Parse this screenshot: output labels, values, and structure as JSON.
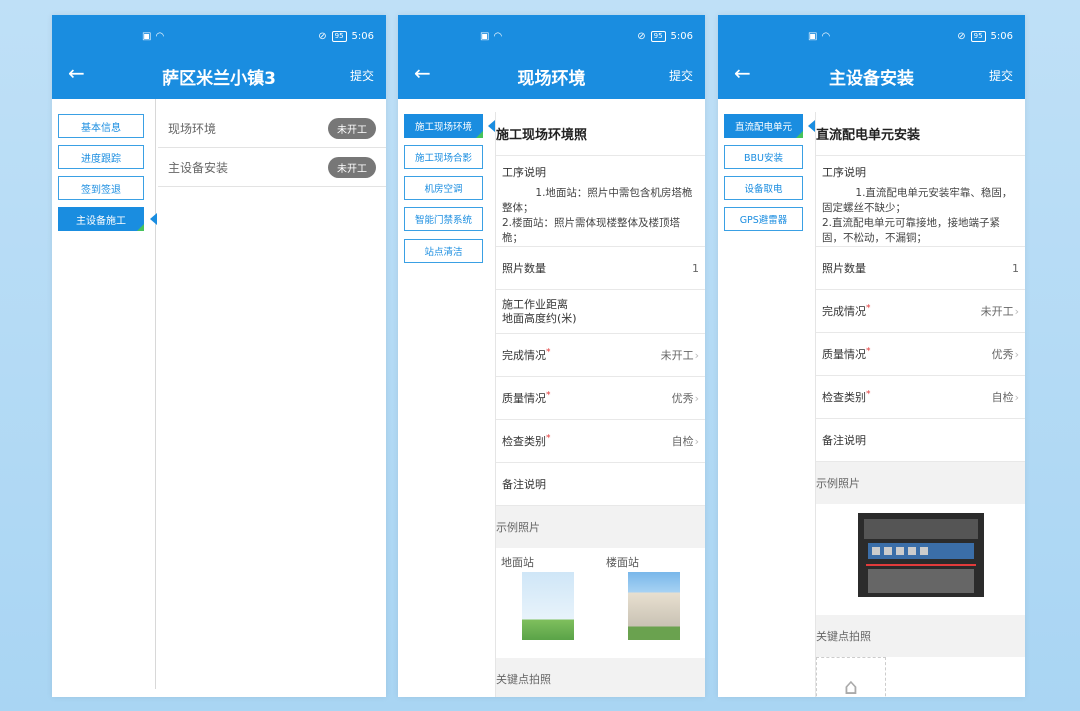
{
  "status": {
    "time": "5:06",
    "battery": "95"
  },
  "panel1": {
    "title": "萨区米兰小镇3",
    "submit": "提交",
    "sidebar": [
      "基本信息",
      "进度跟踪",
      "签到签退",
      "主设备施工"
    ],
    "rows": [
      {
        "label": "现场环境",
        "status": "未开工"
      },
      {
        "label": "主设备安装",
        "status": "未开工"
      }
    ]
  },
  "panel2": {
    "title": "现场环境",
    "submit": "提交",
    "sidebar": [
      "施工现场环境",
      "施工现场合影",
      "机房空调",
      "智能门禁系统",
      "站点清洁"
    ],
    "section_title": "施工现场环境照",
    "desc_label": "工序说明",
    "desc_text": "          1.地面站：照片中需包含机房塔桅整体；\n2.楼面站：照片需体现楼整体及楼顶塔桅；",
    "photo_count_label": "照片数量",
    "photo_count": "1",
    "distance_label": "施工作业距离\n地面高度约(米)",
    "completion_label": "完成情况",
    "completion_value": "未开工",
    "quality_label": "质量情况",
    "quality_value": "优秀",
    "check_label": "检查类别",
    "check_value": "自检",
    "remark_label": "备注说明",
    "sample_title": "示例照片",
    "sample_left": "地面站",
    "sample_right": "楼面站",
    "key_title": "关键点拍照"
  },
  "panel3": {
    "title": "主设备安装",
    "submit": "提交",
    "sidebar": [
      "直流配电单元",
      "BBU安装",
      "设备取电",
      "GPS避雷器"
    ],
    "section_title": "直流配电单元安装",
    "desc_label": "工序说明",
    "desc_text": "          1.直流配电单元安装牢靠、稳固，固定螺丝不缺少；\n2.直流配电单元可靠接地，接地端子紧固，不松动，不漏铜；",
    "photo_count_label": "照片数量",
    "photo_count": "1",
    "completion_label": "完成情况",
    "completion_value": "未开工",
    "quality_label": "质量情况",
    "quality_value": "优秀",
    "check_label": "检查类别",
    "check_value": "自检",
    "remark_label": "备注说明",
    "sample_title": "示例照片",
    "key_title": "关键点拍照"
  }
}
